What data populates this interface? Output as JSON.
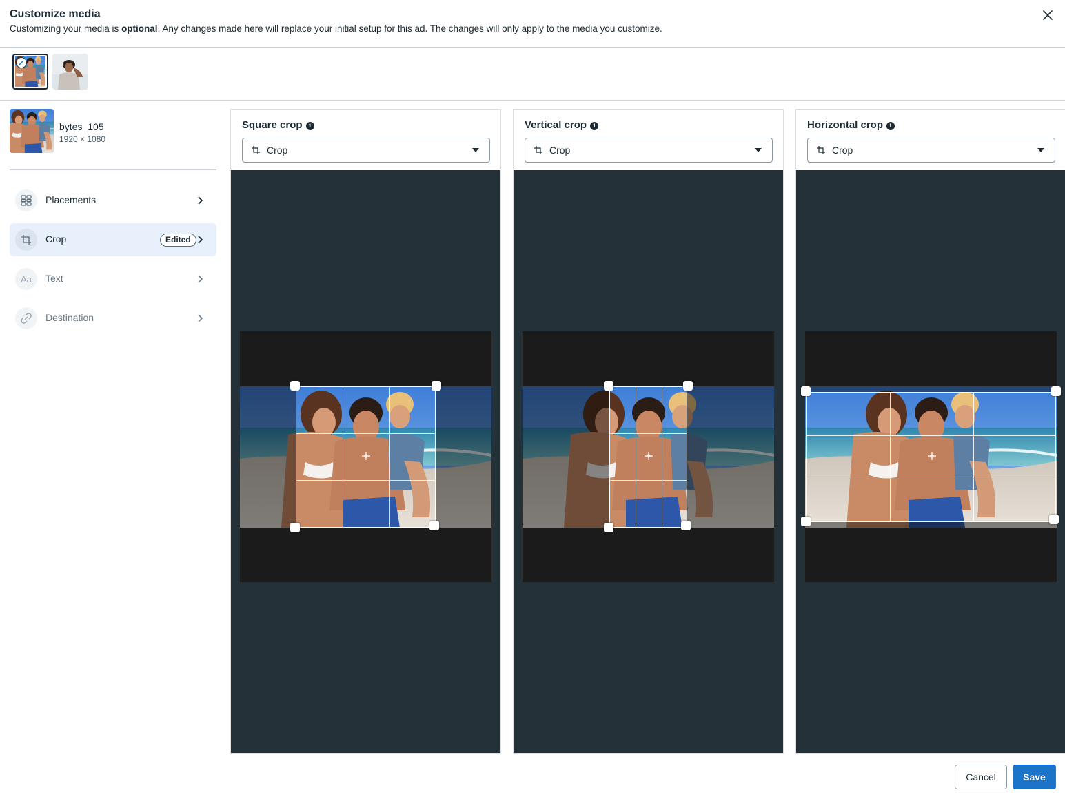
{
  "dialog": {
    "title": "Customize media",
    "subtitle_before": "Customizing your media is ",
    "subtitle_bold": "optional",
    "subtitle_after": ". Any changes made here will replace your initial setup for this ad. The changes will only apply to the media you customize.",
    "close_icon": "close-icon"
  },
  "media": {
    "name": "bytes_105",
    "dimensions": "1920 × 1080"
  },
  "nav": {
    "items": [
      {
        "label": "Placements",
        "icon": "grid-icon"
      },
      {
        "label": "Crop",
        "icon": "crop-icon",
        "badge": "Edited"
      },
      {
        "label": "Text",
        "icon": "text-icon"
      },
      {
        "label": "Destination",
        "icon": "link-icon"
      }
    ]
  },
  "panels": [
    {
      "title": "Square crop",
      "dropdown": "Crop"
    },
    {
      "title": "Vertical crop",
      "dropdown": "Crop"
    },
    {
      "title": "Horizontal crop",
      "dropdown": "Crop"
    }
  ],
  "footer": {
    "cancel_label": "Cancel",
    "save_label": "Save"
  },
  "colors": {
    "accent": "#1b74c8",
    "active_nav_bg": "#e7f0fb",
    "stage_bg": "#243139"
  }
}
